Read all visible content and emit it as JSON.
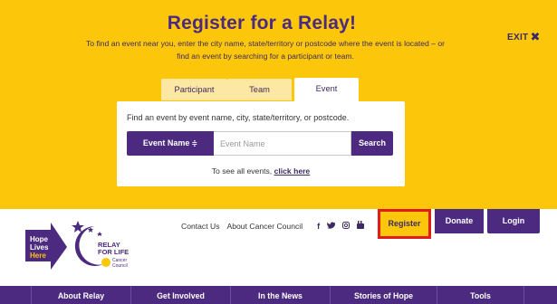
{
  "overlay": {
    "title": "Register for a Relay!",
    "subtitle_line1": "To find an event near you, enter the city name, state/territory or postcode where the event is located – or",
    "subtitle_line2": "find an event by searching for a participant or team.",
    "exit_label": "EXIT",
    "exit_icon": "close-x-icon"
  },
  "tabs": [
    {
      "label": "Participant",
      "active": false
    },
    {
      "label": "Team",
      "active": false
    },
    {
      "label": "Event",
      "active": true
    }
  ],
  "search_panel": {
    "hint": "Find an event by event name, city, state/territory, or postcode.",
    "select_label": "Event Name",
    "select_icon": "sort-caret-icon",
    "input_placeholder": "Event Name",
    "input_value": "",
    "search_button": "Search",
    "see_all_prefix": "To see all events,",
    "see_all_link": "click here"
  },
  "header": {
    "logo": {
      "hope_line1": "Hope",
      "hope_line2": "Lives",
      "hope_line3": "Here",
      "relay_line1": "RELAY",
      "relay_line2": "FOR LIFE",
      "council_line1": "Cancer",
      "council_line2": "Council"
    },
    "links": {
      "contact": "Contact Us",
      "about": "About Cancer Council"
    },
    "social": [
      {
        "icon": "facebook-icon",
        "glyph": "f"
      },
      {
        "icon": "twitter-icon",
        "glyph": "🐦"
      },
      {
        "icon": "instagram-icon",
        "glyph": "◘"
      },
      {
        "icon": "youtube-icon",
        "glyph": "▣"
      }
    ],
    "buttons": {
      "register": "Register",
      "donate": "Donate",
      "login": "Login"
    }
  },
  "nav": {
    "items": [
      "About Relay",
      "Get Involved",
      "In the News",
      "Stories of Hope",
      "Tools"
    ]
  },
  "colors": {
    "yellow": "#fcc70a",
    "purple": "#4b2a80",
    "highlight_red": "#e21b1b"
  }
}
